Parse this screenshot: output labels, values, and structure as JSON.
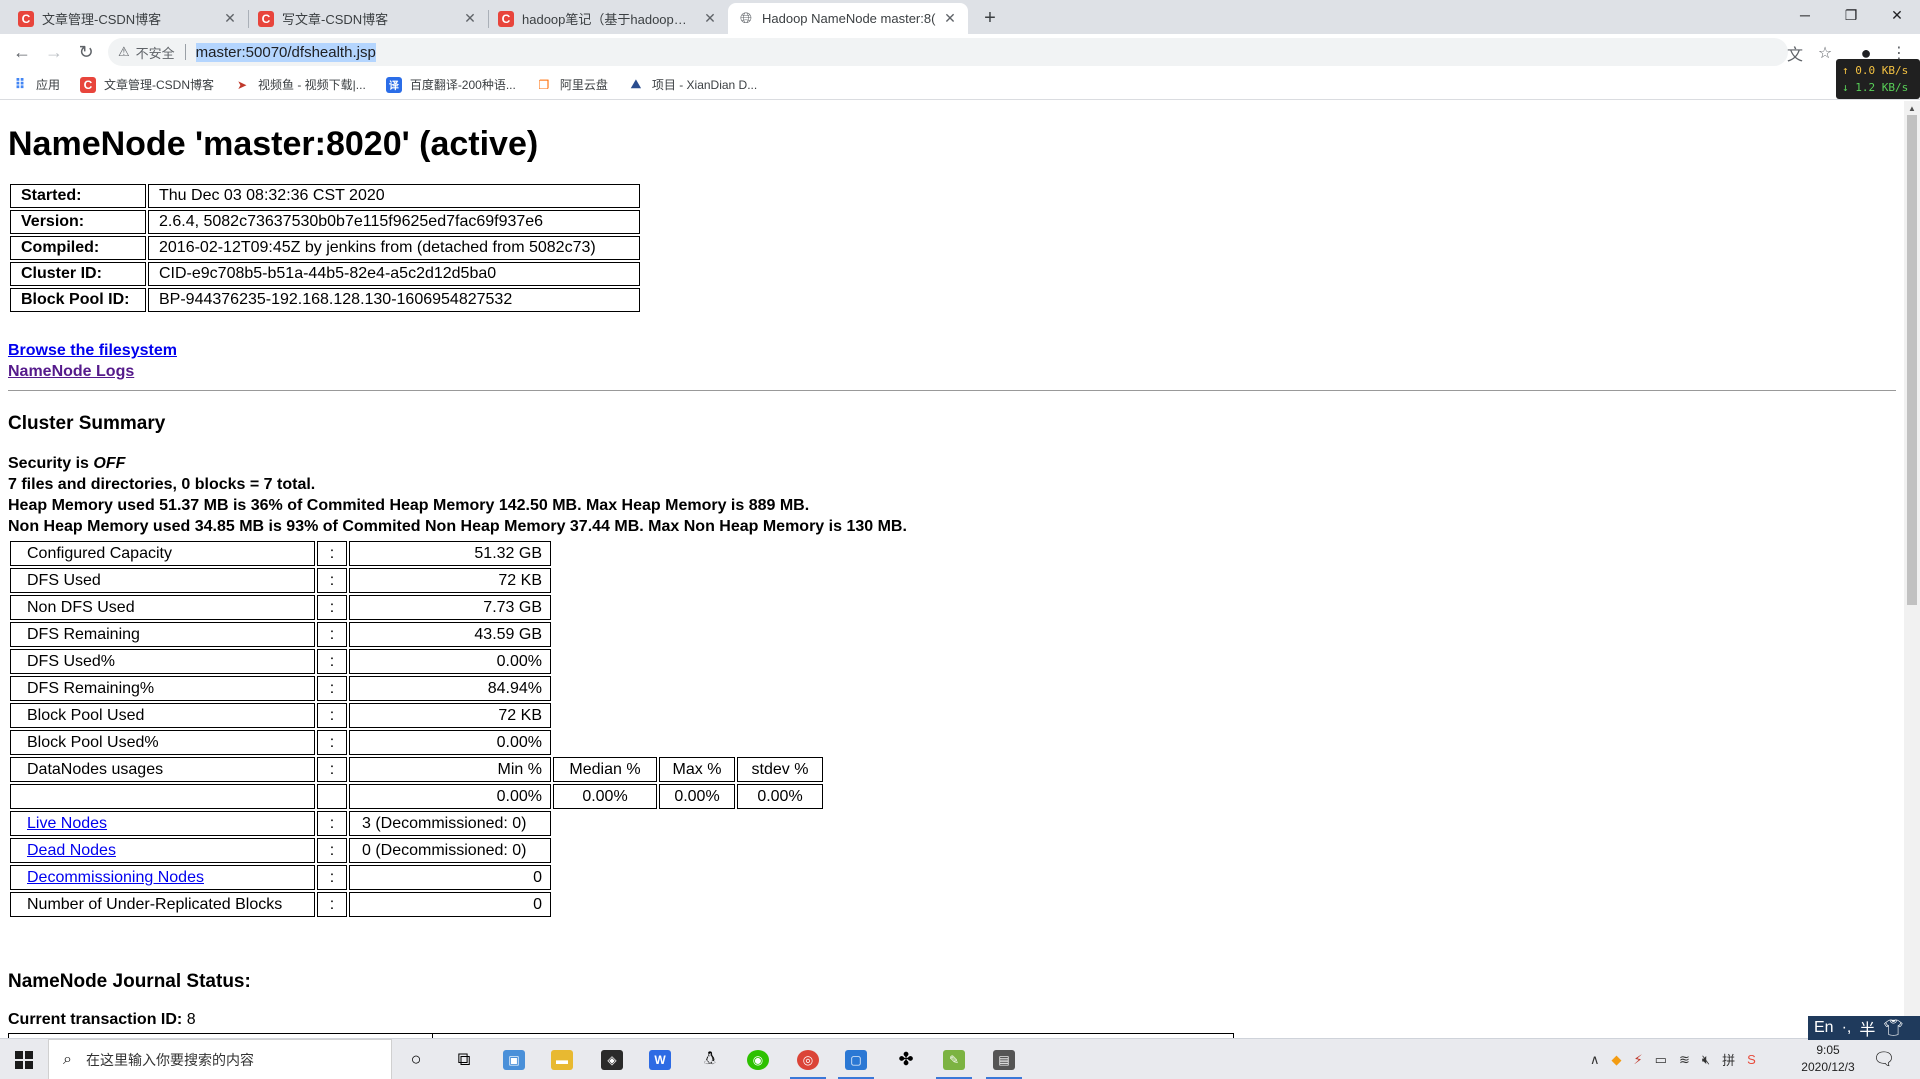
{
  "browser": {
    "tabs": [
      {
        "title": "文章管理-CSDN博客",
        "icon": "csdn-icon",
        "active": false
      },
      {
        "title": "写文章-CSDN博客",
        "icon": "csdn-icon",
        "active": false
      },
      {
        "title": "hadoop笔记（基于hadoop打大",
        "icon": "csdn-icon",
        "active": false
      },
      {
        "title": "Hadoop NameNode master:8(",
        "icon": "globe-icon",
        "active": true
      }
    ],
    "security_label": "不安全",
    "url": "master:50070/dfshealth.jsp",
    "net_up": "↑ 0.0 KB/s",
    "net_down": "↓ 1.2 KB/s",
    "bookmarks": [
      {
        "label": "应用",
        "icon": "apps-grid-icon"
      },
      {
        "label": "文章管理-CSDN博客",
        "icon": "csdn-icon"
      },
      {
        "label": "视频鱼 - 视频下载|...",
        "icon": "video-fish-icon"
      },
      {
        "label": "百度翻译-200种语...",
        "icon": "baidu-translate-icon"
      },
      {
        "label": "阿里云盘",
        "icon": "aliyun-drive-icon"
      },
      {
        "label": "项目 - XianDian D...",
        "icon": "xiandian-icon"
      }
    ]
  },
  "page": {
    "title": "NameNode 'master:8020' (active)",
    "info": [
      {
        "key": "Started:",
        "value": "Thu Dec 03 08:32:36 CST 2020"
      },
      {
        "key": "Version:",
        "value": "2.6.4, 5082c73637530b0b7e115f9625ed7fac69f937e6"
      },
      {
        "key": "Compiled:",
        "value": "2016-02-12T09:45Z by jenkins from (detached from 5082c73)"
      },
      {
        "key": "Cluster ID:",
        "value": "CID-e9c708b5-b51a-44b5-82e4-a5c2d12d5ba0"
      },
      {
        "key": "Block Pool ID:",
        "value": "BP-944376235-192.168.128.130-1606954827532"
      }
    ],
    "link_browse": "Browse the filesystem",
    "link_logs": "NameNode Logs",
    "cluster_summary_title": "Cluster Summary",
    "security_prefix": "Security is ",
    "security_value": "OFF",
    "summary_line1": "7 files and directories, 0 blocks = 7 total.",
    "summary_line2": "Heap Memory used 51.37 MB is 36% of Commited Heap Memory 142.50 MB. Max Heap Memory is 889 MB.",
    "summary_line3": "Non Heap Memory used 34.85 MB is 93% of Commited Non Heap Memory 37.44 MB. Max Non Heap Memory is 130 MB.",
    "colon": ":",
    "stats": [
      {
        "label": "Configured Capacity",
        "value": "51.32 GB"
      },
      {
        "label": "DFS Used",
        "value": "72 KB"
      },
      {
        "label": "Non DFS Used",
        "value": "7.73 GB"
      },
      {
        "label": "DFS Remaining",
        "value": "43.59 GB"
      },
      {
        "label": "DFS Used%",
        "value": "0.00%"
      },
      {
        "label": "DFS Remaining%",
        "value": "84.94%"
      },
      {
        "label": "Block Pool Used",
        "value": "72 KB"
      },
      {
        "label": "Block Pool Used%",
        "value": "0.00%"
      }
    ],
    "usages": {
      "label": "DataNodes usages",
      "headers": [
        "Min %",
        "Median %",
        "Max %",
        "stdev %"
      ],
      "values": [
        "0.00%",
        "0.00%",
        "0.00%",
        "0.00%"
      ]
    },
    "nodes": [
      {
        "label": "Live Nodes",
        "value": "3 (Decommissioned: 0)"
      },
      {
        "label": "Dead Nodes",
        "value": "0 (Decommissioned: 0)"
      },
      {
        "label": "Decommissioning Nodes",
        "value": "0"
      }
    ],
    "under_replicated": {
      "label": "Number of Under-Replicated Blocks",
      "value": "0"
    },
    "journal_title": "NameNode Journal Status:",
    "txid_label": "Current transaction ID:",
    "txid_value": "8"
  },
  "ime": {
    "lang": "En",
    "punct": "·,",
    "width": "半"
  },
  "taskbar": {
    "search_placeholder": "在这里输入你要搜索的内容",
    "time": "9:05",
    "date": "2020/12/3"
  }
}
